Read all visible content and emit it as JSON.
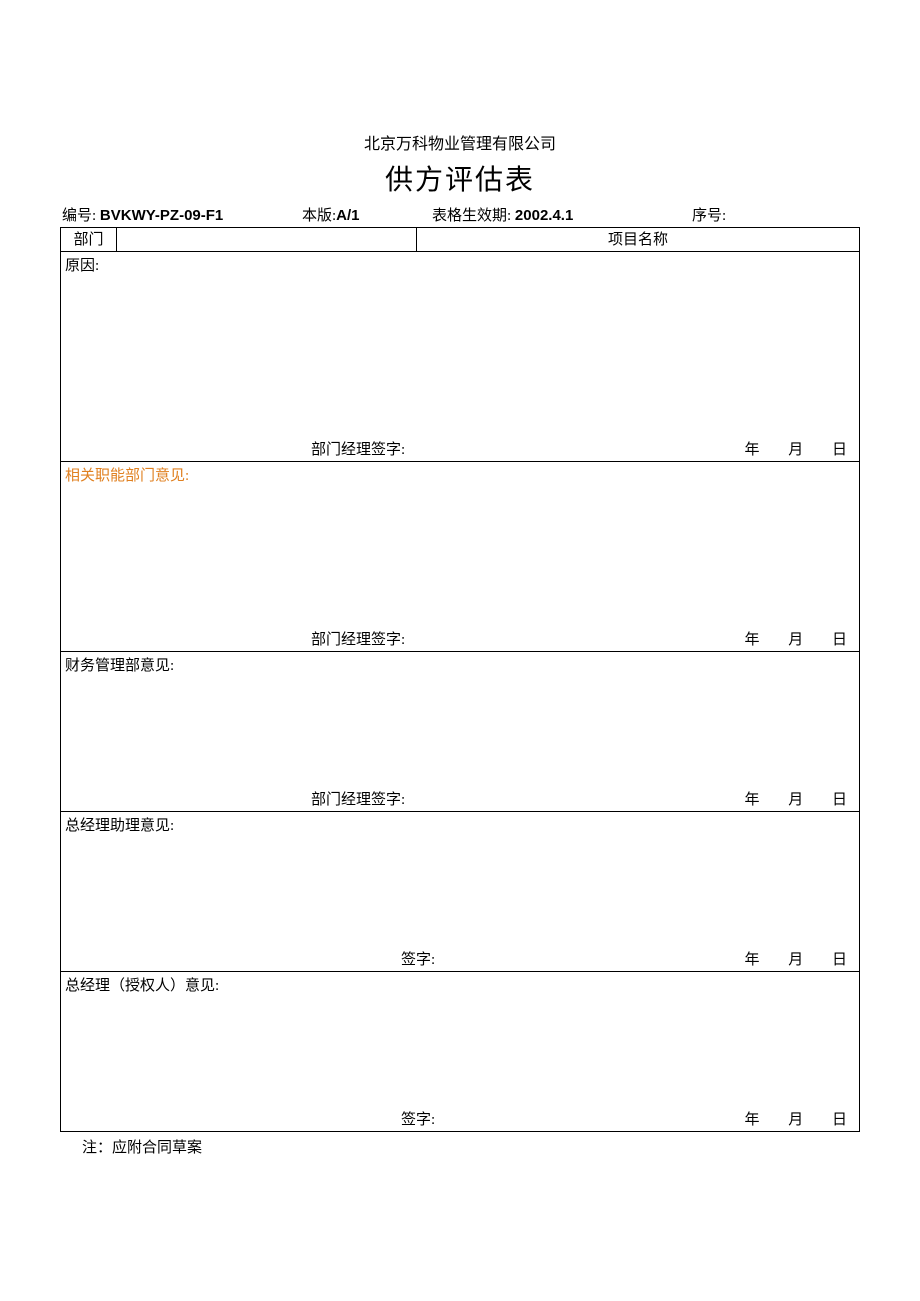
{
  "header": {
    "company": "北京万科物业管理有限公司",
    "title": "供方评估表"
  },
  "meta": {
    "code_label": "编号:",
    "code_value": "BVKWY-PZ-09-F1",
    "version_label": "本版:",
    "version_value": "A/1",
    "effective_label": "表格生效期:",
    "effective_value": "2002.4.1",
    "serial_label": "序号:"
  },
  "row_head": {
    "dept_label": "部门",
    "project_label": "项目名称"
  },
  "sections": {
    "reason": {
      "label": "原因:",
      "sig_label": "部门经理签字:",
      "date_y": "年",
      "date_m": "月",
      "date_d": "日"
    },
    "related": {
      "label": "相关职能部门意见:",
      "sig_label": "部门经理签字:",
      "date_y": "年",
      "date_m": "月",
      "date_d": "日"
    },
    "finance": {
      "label": "财务管理部意见:",
      "sig_label": "部门经理签字:",
      "date_y": "年",
      "date_m": "月",
      "date_d": "日"
    },
    "gm_assistant": {
      "label": "总经理助理意见:",
      "sig_label": "签字:",
      "date_y": "年",
      "date_m": "月",
      "date_d": "日"
    },
    "gm": {
      "label": "总经理（授权人）意见:",
      "sig_label": "签字:",
      "date_y": "年",
      "date_m": "月",
      "date_d": "日"
    }
  },
  "footnote": "注：应附合同草案"
}
